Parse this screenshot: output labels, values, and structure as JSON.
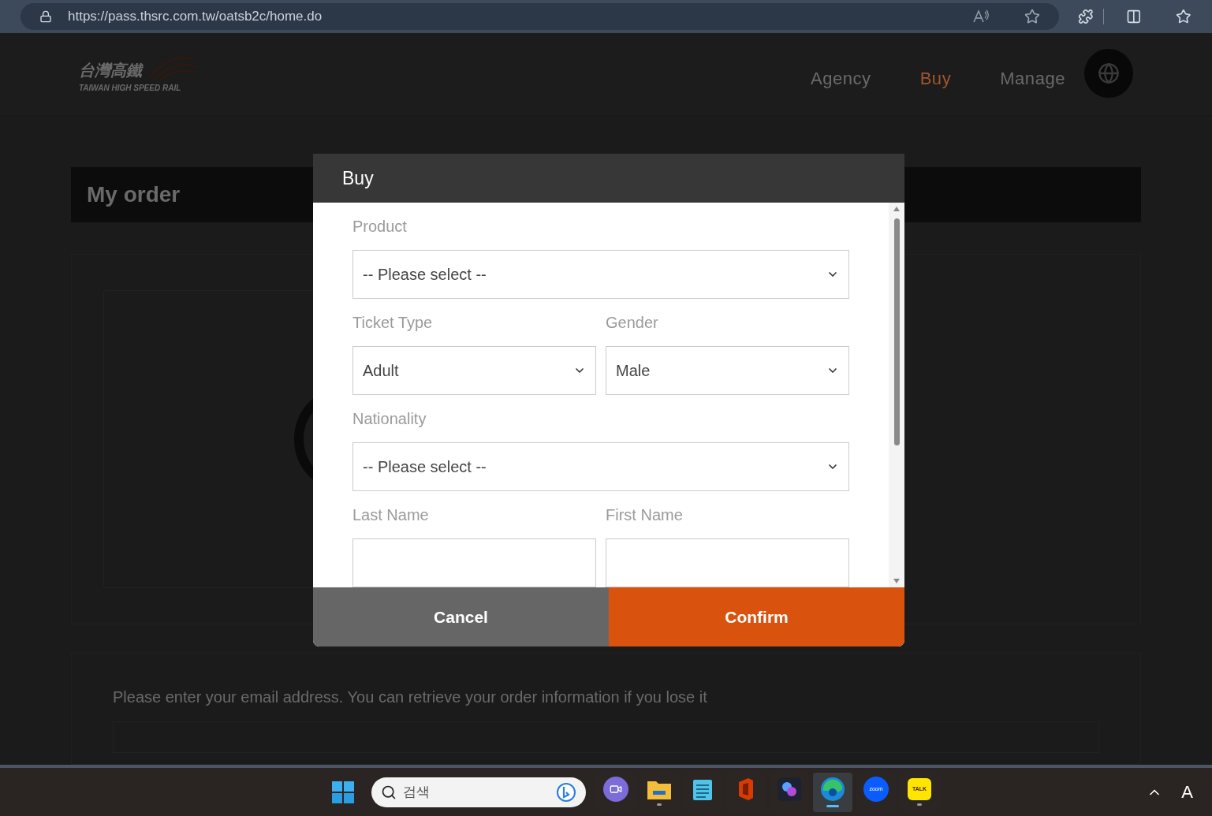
{
  "browser": {
    "url": "https://pass.thsrc.com.tw/oatsb2c/home.do"
  },
  "header": {
    "logo_text": "台灣高鐵",
    "logo_subtext": "TAIWAN HIGH SPEED RAIL",
    "nav": [
      {
        "label": "Agency",
        "selected": false
      },
      {
        "label": "Buy",
        "selected": true
      },
      {
        "label": "Manage",
        "selected": false
      }
    ]
  },
  "page": {
    "title": "My order",
    "email_prompt": "Please enter your email address. You can retrieve your order information if you lose it"
  },
  "modal": {
    "title": "Buy",
    "rows": [
      [
        {
          "label": "Product",
          "kind": "select",
          "value": "-- Please select --"
        }
      ],
      [
        {
          "label": "Ticket Type",
          "kind": "select",
          "value": "Adult"
        },
        {
          "label": "Gender",
          "kind": "select",
          "value": "Male"
        }
      ],
      [
        {
          "label": "Nationality",
          "kind": "select",
          "value": "-- Please select --"
        }
      ],
      [
        {
          "label": "Last Name",
          "kind": "input"
        },
        {
          "label": "First Name",
          "kind": "input"
        }
      ]
    ],
    "buttons": [
      {
        "label": "Cancel",
        "kind": "cancel"
      },
      {
        "label": "Confirm",
        "kind": "confirm"
      }
    ]
  },
  "taskbar": {
    "search_placeholder": "검색",
    "apps": [
      {
        "kind": "chat",
        "running": false,
        "selected": false
      },
      {
        "kind": "folder",
        "running": true,
        "selected": false
      },
      {
        "kind": "notepad",
        "running": false,
        "selected": false
      },
      {
        "kind": "office",
        "running": false,
        "selected": false
      },
      {
        "kind": "copilot",
        "running": false,
        "selected": false
      },
      {
        "kind": "edge",
        "running": true,
        "selected": true
      },
      {
        "kind": "zoom",
        "label": "zoom",
        "running": false,
        "selected": false
      },
      {
        "kind": "talk",
        "label": "TALK",
        "running": true,
        "selected": false
      }
    ],
    "input_indicator": "A"
  }
}
